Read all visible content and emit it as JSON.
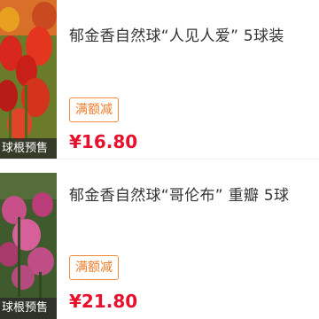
{
  "products": [
    {
      "thumb_tag": "球根预售",
      "title": "郁金香自然球“人见人爱” 5球装",
      "promo_badge": "满额减",
      "price": "¥16.80",
      "image_icon": "red-tulip-photo"
    },
    {
      "thumb_tag": "球根预售",
      "title": "郁金香自然球“哥伦布” 重瓣 5球",
      "promo_badge": "满额减",
      "price": "¥21.80",
      "image_icon": "pink-tulip-photo"
    }
  ],
  "colors": {
    "price": "#e8112d",
    "badge": "#f07a28"
  }
}
